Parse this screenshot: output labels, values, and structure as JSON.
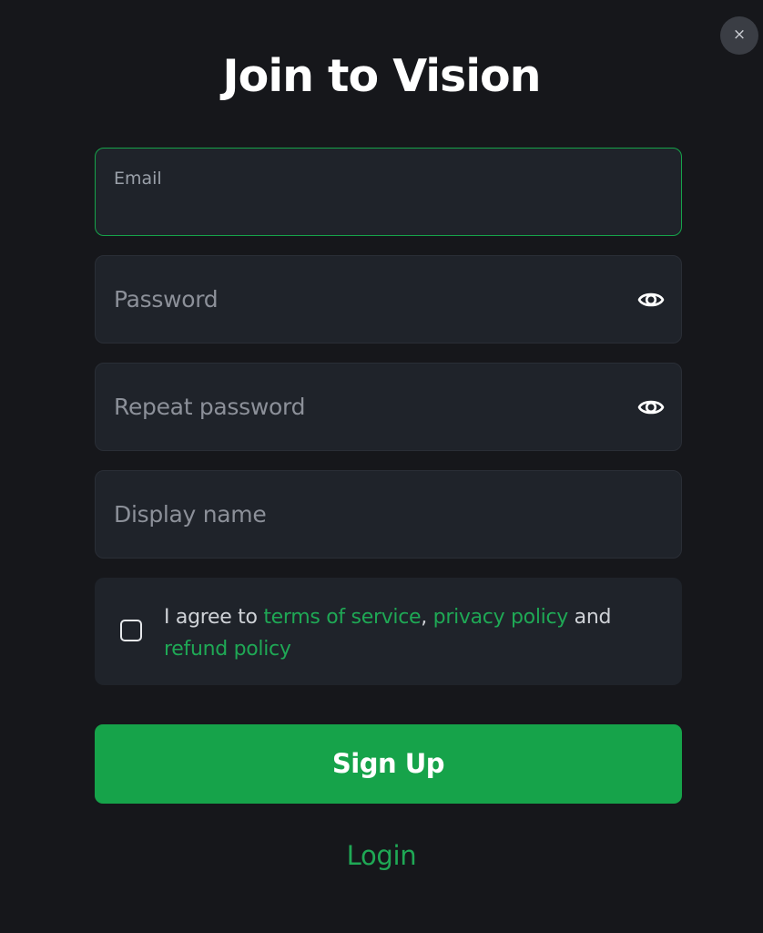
{
  "modal": {
    "close_icon": "×",
    "title": "Join to Vision"
  },
  "form": {
    "email": {
      "label": "Email",
      "value": ""
    },
    "password": {
      "placeholder": "Password",
      "value": "",
      "toggle_icon": "eye-icon"
    },
    "repeat_password": {
      "placeholder": "Repeat password",
      "value": "",
      "toggle_icon": "eye-icon"
    },
    "display_name": {
      "placeholder": "Display name",
      "value": ""
    },
    "agreement": {
      "checked": false,
      "prefix": "I agree to ",
      "terms_link": "terms of service",
      "separator": ",",
      "privacy_link": "privacy policy",
      "conjunction": "and",
      "refund_link": "refund policy"
    },
    "submit_label": "Sign Up",
    "login_label": "Login"
  },
  "colors": {
    "background": "#16171b",
    "field_background": "#1f232a",
    "accent": "#16a34a",
    "link": "#1fa855"
  }
}
